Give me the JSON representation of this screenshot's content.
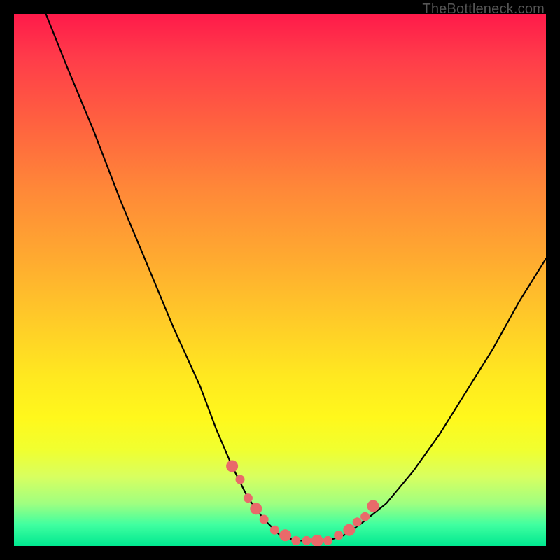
{
  "attribution": "TheBottleneck.com",
  "chart_data": {
    "type": "line",
    "title": "",
    "xlabel": "",
    "ylabel": "",
    "xlim": [
      0,
      100
    ],
    "ylim": [
      0,
      100
    ],
    "series": [
      {
        "name": "curve",
        "x": [
          6,
          10,
          15,
          20,
          25,
          30,
          35,
          38,
          41,
          44,
          47,
          50,
          53,
          56,
          59,
          62,
          65,
          70,
          75,
          80,
          85,
          90,
          95,
          100
        ],
        "values": [
          100,
          90,
          78,
          65,
          53,
          41,
          30,
          22,
          15,
          9,
          5,
          2,
          1,
          1,
          1,
          2,
          4,
          8,
          14,
          21,
          29,
          37,
          46,
          54
        ]
      }
    ],
    "markers": {
      "name": "highlighted-points",
      "color": "#e96a6a",
      "x": [
        41,
        42.5,
        44,
        45.5,
        47,
        49,
        51,
        53,
        55,
        57,
        59,
        61,
        63,
        64.5,
        66,
        67.5
      ],
      "values": [
        15,
        12.5,
        9,
        7,
        5,
        3,
        2,
        1,
        1,
        1,
        1,
        2,
        3,
        4.5,
        5.5,
        7.5
      ]
    }
  }
}
